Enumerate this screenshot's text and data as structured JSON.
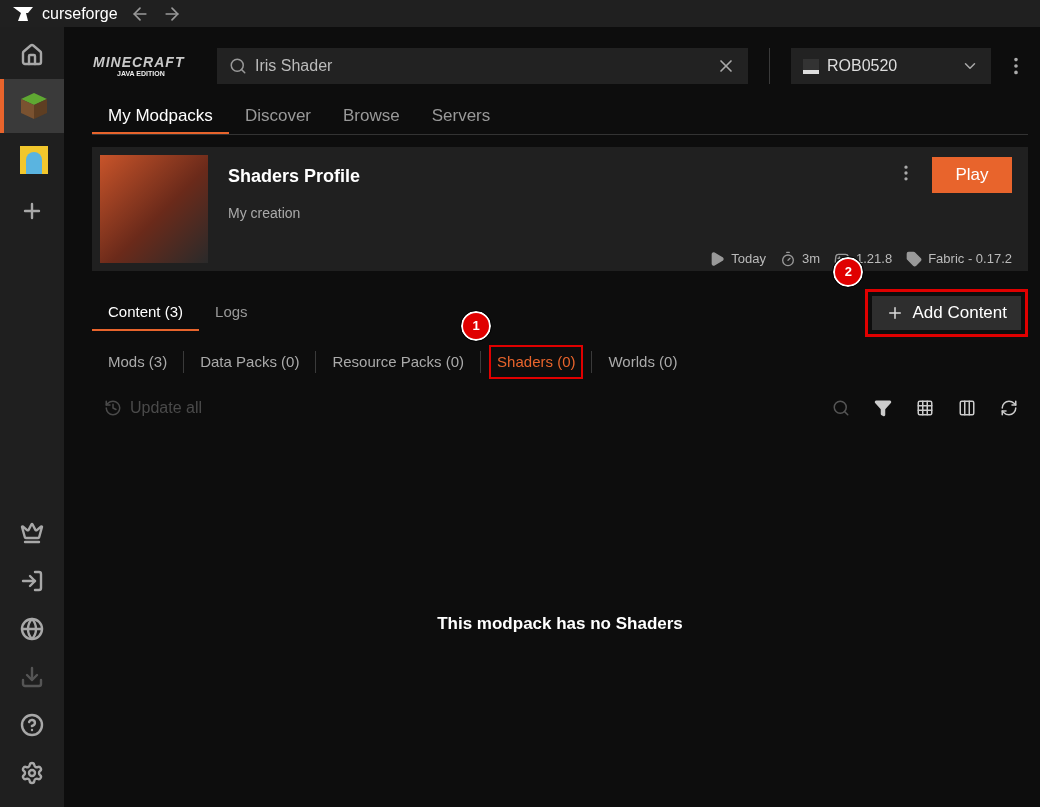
{
  "app": {
    "name": "curseforge"
  },
  "sidebar": {
    "top_items": [
      {
        "kind": "home",
        "selected": false
      },
      {
        "kind": "game",
        "selected": true
      },
      {
        "kind": "avatar",
        "selected": false
      },
      {
        "kind": "add",
        "selected": false
      }
    ],
    "bottom_items": [
      {
        "kind": "premium",
        "disabled": false
      },
      {
        "kind": "login",
        "disabled": false
      },
      {
        "kind": "web",
        "disabled": false
      },
      {
        "kind": "download",
        "disabled": true
      },
      {
        "kind": "help",
        "disabled": false
      },
      {
        "kind": "settings",
        "disabled": false
      }
    ]
  },
  "game_logo": {
    "title": "MINECRAFT",
    "subtitle": "JAVA EDITION"
  },
  "search": {
    "value": "Iris Shader"
  },
  "account": {
    "name": "ROB0520"
  },
  "nav_tabs": [
    {
      "label": "My Modpacks",
      "selected": true
    },
    {
      "label": "Discover",
      "selected": false
    },
    {
      "label": "Browse",
      "selected": false
    },
    {
      "label": "Servers",
      "selected": false
    }
  ],
  "profile": {
    "title": "Shaders Profile",
    "subtitle": "My creation",
    "play_button": "Play",
    "meta": [
      {
        "kind": "played",
        "text": "Today"
      },
      {
        "kind": "time",
        "text": "3m"
      },
      {
        "kind": "version",
        "text": "1.21.8"
      },
      {
        "kind": "loader",
        "text": "Fabric - 0.17.2"
      }
    ]
  },
  "content_tabs": [
    {
      "label": "Content (3)",
      "selected": true
    },
    {
      "label": "Logs",
      "selected": false
    }
  ],
  "add_button": {
    "label": "Add Content",
    "annotation": "2"
  },
  "category_tabs": [
    {
      "label": "Mods (3)",
      "selected": false
    },
    {
      "label": "Data Packs (0)",
      "selected": false
    },
    {
      "label": "Resource Packs (0)",
      "selected": false
    },
    {
      "label": "Shaders (0)",
      "selected": true,
      "annotation": "1"
    },
    {
      "label": "Worlds (0)",
      "selected": false
    }
  ],
  "update_button": {
    "label": "Update all",
    "disabled": true
  },
  "empty_message": "This modpack has no Shaders"
}
